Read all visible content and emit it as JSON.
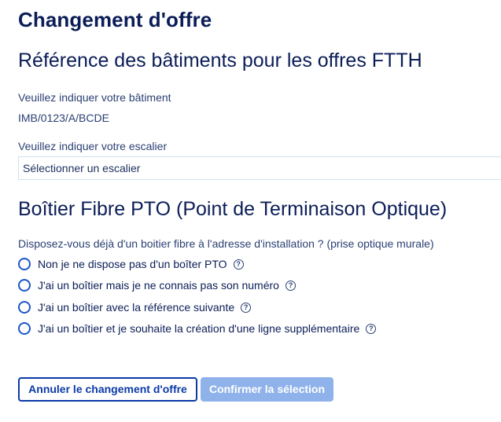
{
  "header": {
    "title": "Changement d'offre"
  },
  "building": {
    "section_title": "Référence des bâtiments pour les offres FTTH",
    "building_label": "Veuillez indiquer votre bâtiment",
    "building_value": "IMB/0123/A/BCDE",
    "stair_label": "Veuillez indiquer votre escalier",
    "stair_select_value": "Sélectionner un escalier"
  },
  "pto": {
    "section_title": "Boîtier Fibre PTO (Point de Terminaison Optique)",
    "question": "Disposez-vous déjà d'un boitier fibre à l'adresse d'installation ? (prise optique murale)",
    "options": [
      {
        "label": "Non je ne dispose pas d'un boîter PTO",
        "selected": false
      },
      {
        "label": "J'ai un boîtier mais je ne connais pas son numéro",
        "selected": false
      },
      {
        "label": "J'ai un boîtier avec la référence suivante",
        "selected": false
      },
      {
        "label": "J'ai un boîtier et je souhaite la création d'une ligne supplémentaire",
        "selected": false
      }
    ],
    "help_glyph": "?"
  },
  "actions": {
    "cancel_label": "Annuler le changement d'offre",
    "confirm_label": "Confirmer la sélection"
  },
  "colors": {
    "primary_text": "#0b1d57",
    "accent_blue": "#0b3aa8",
    "radio_blue": "#1c56c9",
    "disabled_button": "#8fb2ea"
  },
  "icons": {
    "help": "question-circle-icon",
    "radio": "radio-empty-icon"
  }
}
